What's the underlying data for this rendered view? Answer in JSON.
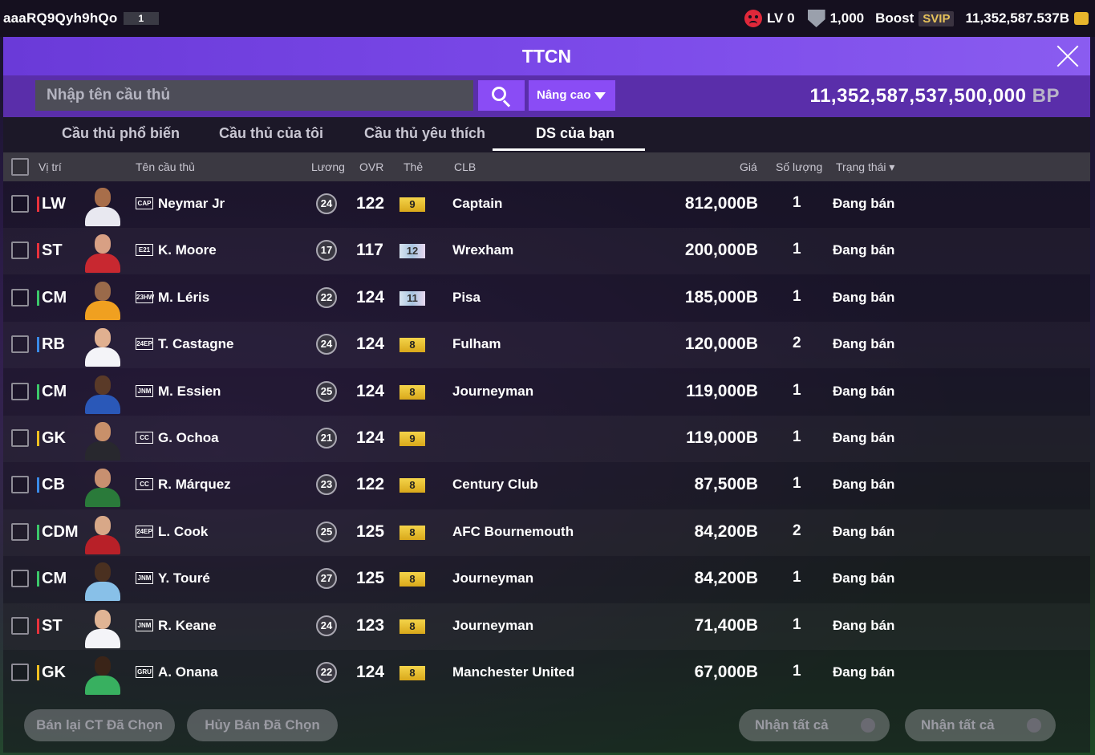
{
  "topbar": {
    "username": "aaaRQ9Qyh9hQo",
    "badge": "1",
    "level": "LV 0",
    "shield_count": "1,000",
    "boost_label": "Boost",
    "svip_label": "SVIP",
    "balance": "11,352,587.537B"
  },
  "panel": {
    "title": "TTCN",
    "search_placeholder": "Nhập tên cầu thủ",
    "advanced_label": "Nâng cao",
    "bp_amount": "11,352,587,537,500,000",
    "bp_unit": "BP"
  },
  "tabs": [
    {
      "label": "Cầu thủ phổ biến"
    },
    {
      "label": "Cầu thủ của tôi"
    },
    {
      "label": "Cầu thủ yêu thích"
    },
    {
      "label": "DS của bạn"
    }
  ],
  "columns": {
    "position": "Vị trí",
    "player": "Tên cầu thủ",
    "salary": "Lương",
    "ovr": "OVR",
    "card": "Thẻ",
    "club": "CLB",
    "price": "Giá",
    "qty": "Số lượng",
    "status": "Trạng thái"
  },
  "rows": [
    {
      "pos": "LW",
      "pos_color": "#e8323c",
      "season": "CAP",
      "name": "Neymar Jr",
      "salary": "24",
      "ovr": "122",
      "card": "9",
      "card_type": "gold",
      "club": "Captain",
      "price": "812,000B",
      "qty": "1",
      "status": "Đang bán",
      "skin": "#a86e4a",
      "shirt": "#e8e8f0"
    },
    {
      "pos": "ST",
      "pos_color": "#e8323c",
      "season": "E21",
      "name": "K. Moore",
      "salary": "17",
      "ovr": "117",
      "card": "12",
      "card_type": "silver",
      "club": "Wrexham",
      "price": "200,000B",
      "qty": "1",
      "status": "Đang bán",
      "skin": "#d8a084",
      "shirt": "#c82830"
    },
    {
      "pos": "CM",
      "pos_color": "#3cc86a",
      "season": "23HW",
      "name": "M. Léris",
      "salary": "22",
      "ovr": "124",
      "card": "11",
      "card_type": "silver",
      "club": "Pisa",
      "price": "185,000B",
      "qty": "1",
      "status": "Đang bán",
      "skin": "#9a6a4a",
      "shirt": "#f0a020"
    },
    {
      "pos": "RB",
      "pos_color": "#3a8ae8",
      "season": "24EP",
      "name": "T. Castagne",
      "salary": "24",
      "ovr": "124",
      "card": "8",
      "card_type": "gold",
      "club": "Fulham",
      "price": "120,000B",
      "qty": "2",
      "status": "Đang bán",
      "skin": "#e0b090",
      "shirt": "#f4f4f8"
    },
    {
      "pos": "CM",
      "pos_color": "#3cc86a",
      "season": "JNM",
      "name": "M. Essien",
      "salary": "25",
      "ovr": "124",
      "card": "8",
      "card_type": "gold",
      "club": "Journeyman",
      "price": "119,000B",
      "qty": "1",
      "status": "Đang bán",
      "skin": "#5a3a28",
      "shirt": "#2a58b8"
    },
    {
      "pos": "GK",
      "pos_color": "#f0c020",
      "season": "CC",
      "name": "G. Ochoa",
      "salary": "21",
      "ovr": "124",
      "card": "9",
      "card_type": "gold",
      "club": "",
      "price": "119,000B",
      "qty": "1",
      "status": "Đang bán",
      "skin": "#c8906a",
      "shirt": "#28282e"
    },
    {
      "pos": "CB",
      "pos_color": "#3a8ae8",
      "season": "CC",
      "name": "R. Márquez",
      "salary": "23",
      "ovr": "122",
      "card": "8",
      "card_type": "gold",
      "club": "Century Club",
      "price": "87,500B",
      "qty": "1",
      "status": "Đang bán",
      "skin": "#c89070",
      "shirt": "#2a7a3a"
    },
    {
      "pos": "CDM",
      "pos_color": "#3cc86a",
      "season": "24EP",
      "name": "L. Cook",
      "salary": "25",
      "ovr": "125",
      "card": "8",
      "card_type": "gold",
      "club": "AFC Bournemouth",
      "price": "84,200B",
      "qty": "2",
      "status": "Đang bán",
      "skin": "#d8a888",
      "shirt": "#b82028"
    },
    {
      "pos": "CM",
      "pos_color": "#3cc86a",
      "season": "JNM",
      "name": "Y. Touré",
      "salary": "27",
      "ovr": "125",
      "card": "8",
      "card_type": "gold",
      "club": "Journeyman",
      "price": "84,200B",
      "qty": "1",
      "status": "Đang bán",
      "skin": "#4a3020",
      "shirt": "#88c0e8"
    },
    {
      "pos": "ST",
      "pos_color": "#e8323c",
      "season": "JNM",
      "name": "R. Keane",
      "salary": "24",
      "ovr": "123",
      "card": "8",
      "card_type": "gold",
      "club": "Journeyman",
      "price": "71,400B",
      "qty": "1",
      "status": "Đang bán",
      "skin": "#e0b494",
      "shirt": "#f4f4f8"
    },
    {
      "pos": "GK",
      "pos_color": "#f0c020",
      "season": "GRU",
      "name": "A. Onana",
      "salary": "22",
      "ovr": "124",
      "card": "8",
      "card_type": "gold",
      "club": "Manchester United",
      "price": "67,000B",
      "qty": "1",
      "status": "Đang bán",
      "skin": "#3a2418",
      "shirt": "#38b060"
    }
  ],
  "footer": {
    "resell_label": "Bán lại CT Đã Chọn",
    "cancel_label": "Hủy Bán Đã Chọn",
    "claim_all_1": "Nhận tất cả",
    "claim_all_2": "Nhận tất cả"
  }
}
